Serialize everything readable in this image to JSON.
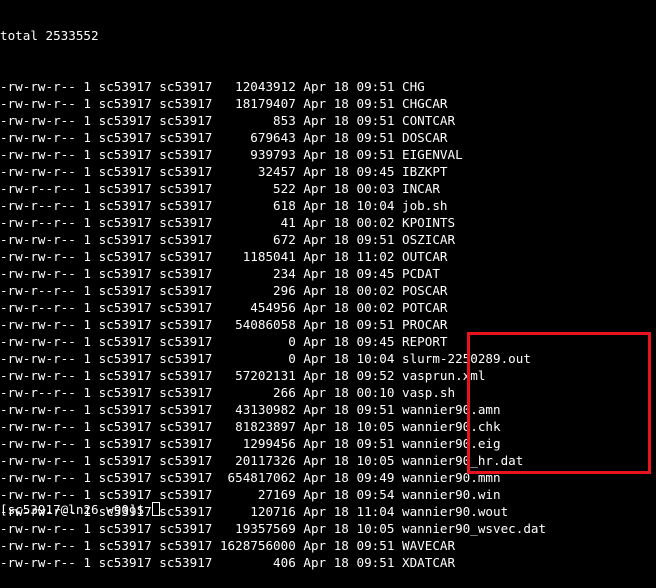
{
  "terminal": {
    "total_line": "total 2533552",
    "listing": [
      {
        "perms": "-rw-rw-r--",
        "links": "1",
        "owner": "sc53917",
        "group": "sc53917",
        "size": "12043912",
        "month": "Apr",
        "day": "18",
        "time": "09:51",
        "name": "CHG"
      },
      {
        "perms": "-rw-rw-r--",
        "links": "1",
        "owner": "sc53917",
        "group": "sc53917",
        "size": "18179407",
        "month": "Apr",
        "day": "18",
        "time": "09:51",
        "name": "CHGCAR"
      },
      {
        "perms": "-rw-rw-r--",
        "links": "1",
        "owner": "sc53917",
        "group": "sc53917",
        "size": "853",
        "month": "Apr",
        "day": "18",
        "time": "09:51",
        "name": "CONTCAR"
      },
      {
        "perms": "-rw-rw-r--",
        "links": "1",
        "owner": "sc53917",
        "group": "sc53917",
        "size": "679643",
        "month": "Apr",
        "day": "18",
        "time": "09:51",
        "name": "DOSCAR"
      },
      {
        "perms": "-rw-rw-r--",
        "links": "1",
        "owner": "sc53917",
        "group": "sc53917",
        "size": "939793",
        "month": "Apr",
        "day": "18",
        "time": "09:51",
        "name": "EIGENVAL"
      },
      {
        "perms": "-rw-rw-r--",
        "links": "1",
        "owner": "sc53917",
        "group": "sc53917",
        "size": "32457",
        "month": "Apr",
        "day": "18",
        "time": "09:45",
        "name": "IBZKPT"
      },
      {
        "perms": "-rw-r--r--",
        "links": "1",
        "owner": "sc53917",
        "group": "sc53917",
        "size": "522",
        "month": "Apr",
        "day": "18",
        "time": "00:03",
        "name": "INCAR"
      },
      {
        "perms": "-rw-r--r--",
        "links": "1",
        "owner": "sc53917",
        "group": "sc53917",
        "size": "618",
        "month": "Apr",
        "day": "18",
        "time": "10:04",
        "name": "job.sh"
      },
      {
        "perms": "-rw-r--r--",
        "links": "1",
        "owner": "sc53917",
        "group": "sc53917",
        "size": "41",
        "month": "Apr",
        "day": "18",
        "time": "00:02",
        "name": "KPOINTS"
      },
      {
        "perms": "-rw-rw-r--",
        "links": "1",
        "owner": "sc53917",
        "group": "sc53917",
        "size": "672",
        "month": "Apr",
        "day": "18",
        "time": "09:51",
        "name": "OSZICAR"
      },
      {
        "perms": "-rw-rw-r--",
        "links": "1",
        "owner": "sc53917",
        "group": "sc53917",
        "size": "1185041",
        "month": "Apr",
        "day": "18",
        "time": "11:02",
        "name": "OUTCAR"
      },
      {
        "perms": "-rw-rw-r--",
        "links": "1",
        "owner": "sc53917",
        "group": "sc53917",
        "size": "234",
        "month": "Apr",
        "day": "18",
        "time": "09:45",
        "name": "PCDAT"
      },
      {
        "perms": "-rw-r--r--",
        "links": "1",
        "owner": "sc53917",
        "group": "sc53917",
        "size": "296",
        "month": "Apr",
        "day": "18",
        "time": "00:02",
        "name": "POSCAR"
      },
      {
        "perms": "-rw-r--r--",
        "links": "1",
        "owner": "sc53917",
        "group": "sc53917",
        "size": "454956",
        "month": "Apr",
        "day": "18",
        "time": "00:02",
        "name": "POTCAR"
      },
      {
        "perms": "-rw-rw-r--",
        "links": "1",
        "owner": "sc53917",
        "group": "sc53917",
        "size": "54086058",
        "month": "Apr",
        "day": "18",
        "time": "09:51",
        "name": "PROCAR"
      },
      {
        "perms": "-rw-rw-r--",
        "links": "1",
        "owner": "sc53917",
        "group": "sc53917",
        "size": "0",
        "month": "Apr",
        "day": "18",
        "time": "09:45",
        "name": "REPORT"
      },
      {
        "perms": "-rw-rw-r--",
        "links": "1",
        "owner": "sc53917",
        "group": "sc53917",
        "size": "0",
        "month": "Apr",
        "day": "18",
        "time": "10:04",
        "name": "slurm-2250289.out"
      },
      {
        "perms": "-rw-rw-r--",
        "links": "1",
        "owner": "sc53917",
        "group": "sc53917",
        "size": "57202131",
        "month": "Apr",
        "day": "18",
        "time": "09:52",
        "name": "vasprun.xml"
      },
      {
        "perms": "-rw-r--r--",
        "links": "1",
        "owner": "sc53917",
        "group": "sc53917",
        "size": "266",
        "month": "Apr",
        "day": "18",
        "time": "00:10",
        "name": "vasp.sh"
      },
      {
        "perms": "-rw-rw-r--",
        "links": "1",
        "owner": "sc53917",
        "group": "sc53917",
        "size": "43130982",
        "month": "Apr",
        "day": "18",
        "time": "09:51",
        "name": "wannier90.amn"
      },
      {
        "perms": "-rw-rw-r--",
        "links": "1",
        "owner": "sc53917",
        "group": "sc53917",
        "size": "81823897",
        "month": "Apr",
        "day": "18",
        "time": "10:05",
        "name": "wannier90.chk"
      },
      {
        "perms": "-rw-rw-r--",
        "links": "1",
        "owner": "sc53917",
        "group": "sc53917",
        "size": "1299456",
        "month": "Apr",
        "day": "18",
        "time": "09:51",
        "name": "wannier90.eig"
      },
      {
        "perms": "-rw-rw-r--",
        "links": "1",
        "owner": "sc53917",
        "group": "sc53917",
        "size": "20117326",
        "month": "Apr",
        "day": "18",
        "time": "10:05",
        "name": "wannier90_hr.dat"
      },
      {
        "perms": "-rw-rw-r--",
        "links": "1",
        "owner": "sc53917",
        "group": "sc53917",
        "size": "654817062",
        "month": "Apr",
        "day": "18",
        "time": "09:49",
        "name": "wannier90.mmn"
      },
      {
        "perms": "-rw-rw-r--",
        "links": "1",
        "owner": "sc53917",
        "group": "sc53917",
        "size": "27169",
        "month": "Apr",
        "day": "18",
        "time": "09:54",
        "name": "wannier90.win"
      },
      {
        "perms": "-rw-rw-r--",
        "links": "1",
        "owner": "sc53917",
        "group": "sc53917",
        "size": "120716",
        "month": "Apr",
        "day": "18",
        "time": "11:04",
        "name": "wannier90.wout"
      },
      {
        "perms": "-rw-rw-r--",
        "links": "1",
        "owner": "sc53917",
        "group": "sc53917",
        "size": "19357569",
        "month": "Apr",
        "day": "18",
        "time": "10:05",
        "name": "wannier90_wsvec.dat"
      },
      {
        "perms": "-rw-rw-r--",
        "links": "1",
        "owner": "sc53917",
        "group": "sc53917",
        "size": "1628756000",
        "month": "Apr",
        "day": "18",
        "time": "09:51",
        "name": "WAVECAR"
      },
      {
        "perms": "-rw-rw-r--",
        "links": "1",
        "owner": "sc53917",
        "group": "sc53917",
        "size": "406",
        "month": "Apr",
        "day": "18",
        "time": "09:51",
        "name": "XDATCAR"
      }
    ],
    "prompt_partial": "[sc53917@ln26 w90]$",
    "colors": {
      "background": "#000000",
      "text": "#ffffff",
      "highlight_border": "#e8131d"
    }
  }
}
